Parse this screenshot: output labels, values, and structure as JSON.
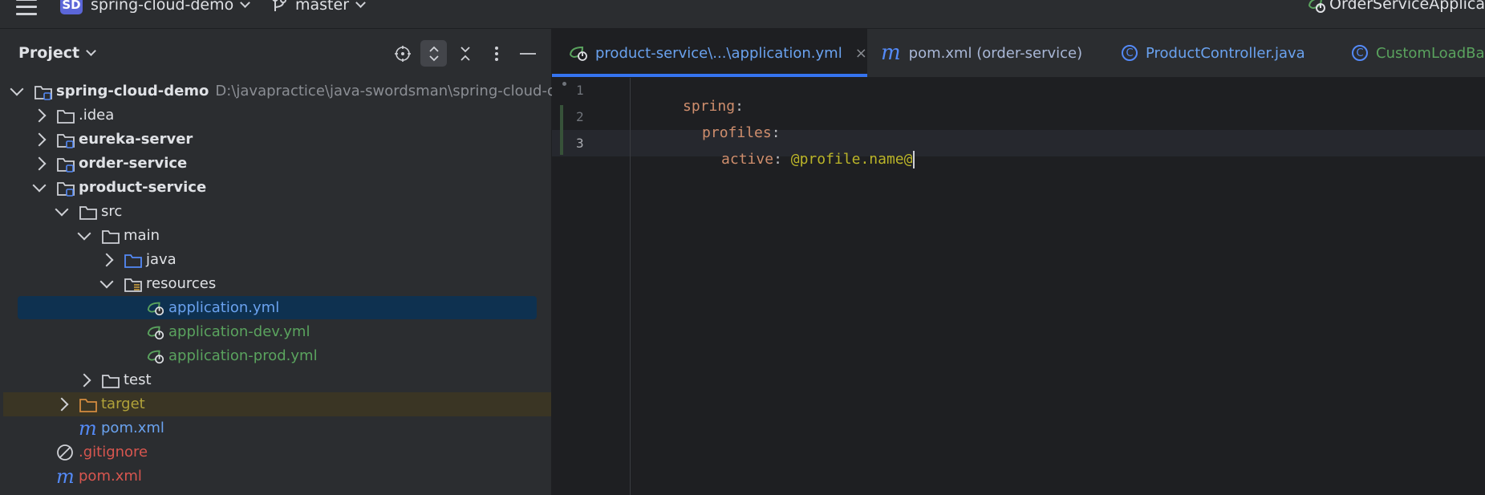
{
  "titlebar": {
    "project_badge": "SD",
    "project_name": "spring-cloud-demo",
    "branch": "master",
    "run_config": "OrderServiceApplica"
  },
  "project_panel": {
    "title": "Project",
    "tools": [
      "locate-icon",
      "expand-collapse-icon",
      "collapse-all-icon",
      "more-icon",
      "minimize-icon"
    ],
    "tree": [
      {
        "label": "spring-cloud-demo",
        "extra": "D:\\javapractice\\java-swordsman\\spring-cloud-dem",
        "indent": 0,
        "state": "expanded",
        "icon": "module-folder-icon"
      },
      {
        "label": ".idea",
        "indent": 1,
        "state": "collapsed",
        "icon": "folder-icon"
      },
      {
        "label": "eureka-server",
        "indent": 1,
        "state": "collapsed",
        "icon": "module-folder-icon"
      },
      {
        "label": "order-service",
        "indent": 1,
        "state": "collapsed",
        "icon": "module-folder-icon"
      },
      {
        "label": "product-service",
        "indent": 1,
        "state": "expanded",
        "icon": "module-folder-icon"
      },
      {
        "label": "src",
        "indent": 2,
        "state": "expanded",
        "icon": "folder-icon"
      },
      {
        "label": "main",
        "indent": 3,
        "state": "expanded",
        "icon": "folder-icon"
      },
      {
        "label": "java",
        "indent": 4,
        "state": "collapsed",
        "icon": "source-folder-icon"
      },
      {
        "label": "resources",
        "indent": 4,
        "state": "expanded",
        "icon": "resources-folder-icon"
      },
      {
        "label": "application.yml",
        "indent": 5,
        "state": "leaf",
        "icon": "spring-yml-icon",
        "selected": true
      },
      {
        "label": "application-dev.yml",
        "indent": 5,
        "state": "leaf",
        "icon": "spring-yml-icon"
      },
      {
        "label": "application-prod.yml",
        "indent": 5,
        "state": "leaf",
        "icon": "spring-yml-icon"
      },
      {
        "label": "test",
        "indent": 3,
        "state": "collapsed",
        "icon": "folder-icon"
      },
      {
        "label": "target",
        "indent": 2,
        "state": "collapsed",
        "icon": "excluded-folder-icon",
        "excluded": true
      },
      {
        "label": "pom.xml",
        "indent": 2,
        "state": "leaf",
        "icon": "maven-icon"
      },
      {
        "label": ".gitignore",
        "indent": 1,
        "state": "leaf",
        "icon": "ignored-icon"
      },
      {
        "label": "pom.xml",
        "indent": 1,
        "state": "leaf",
        "icon": "maven-icon"
      }
    ]
  },
  "editor": {
    "tabs": [
      {
        "label": "product-service\\...\\application.yml",
        "icon": "spring-yml-icon",
        "active": true
      },
      {
        "label": "pom.xml (order-service)",
        "icon": "maven-icon"
      },
      {
        "label": "ProductController.java",
        "icon": "class-icon"
      },
      {
        "label": "CustomLoadBal",
        "icon": "class-icon"
      }
    ],
    "lines": [
      {
        "num": "1",
        "key": "spring",
        "sep": ":"
      },
      {
        "num": "2",
        "key": "profiles",
        "sep": ":"
      },
      {
        "num": "3",
        "key": "active",
        "sep": ": ",
        "value": "@profile.name@"
      }
    ]
  },
  "colors": {
    "accent": "#3574f0",
    "selection": "#0e3150",
    "yaml_key": "#cf8e6d",
    "yaml_value": "#bbb529"
  }
}
